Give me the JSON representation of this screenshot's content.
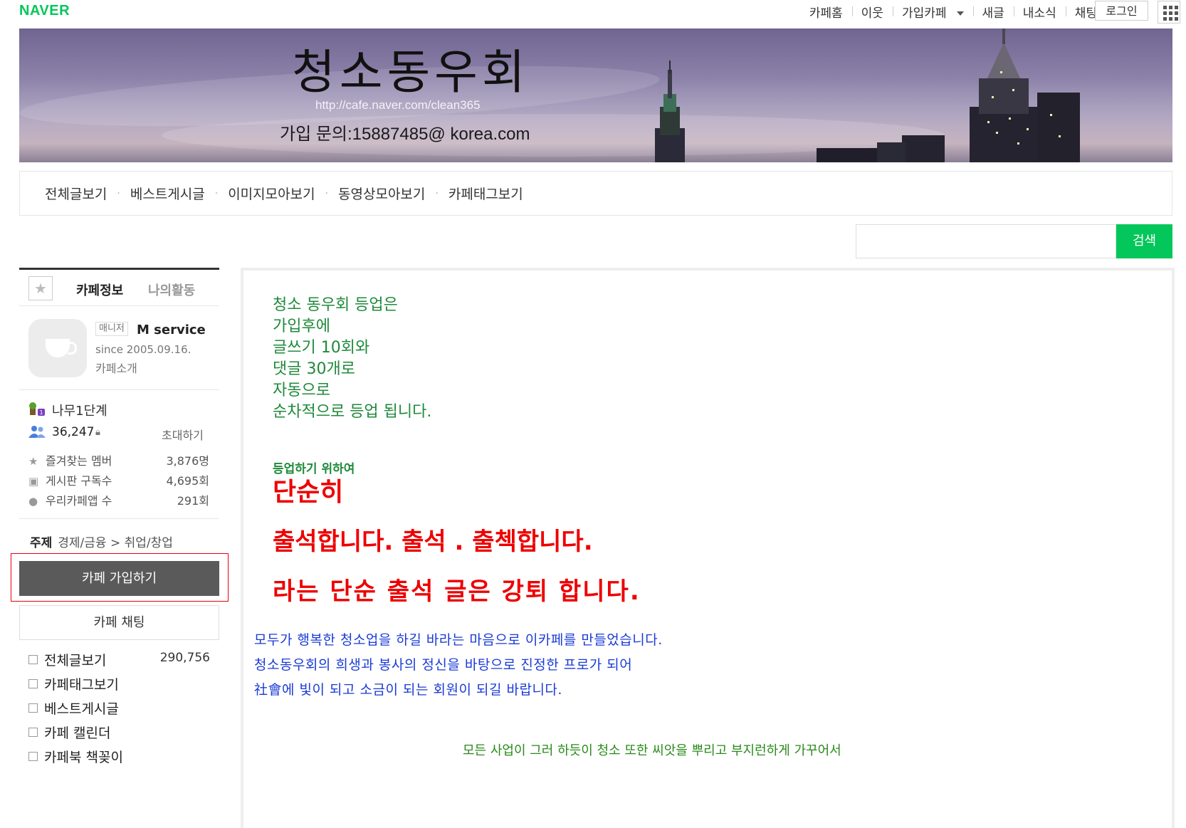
{
  "header": {
    "logo": "NAVER",
    "nav": [
      "카페홈",
      "이웃",
      "가입카페",
      "새글",
      "내소식",
      "채팅"
    ],
    "login": "로그인"
  },
  "banner": {
    "title": "청소동우회",
    "url": "http://cafe.naver.com/clean365",
    "contact": "가입 문의:15887485@ korea.com"
  },
  "menubar": [
    "전체글보기",
    "베스트게시글",
    "이미지모아보기",
    "동영상모아보기",
    "카페태그보기"
  ],
  "search": {
    "button": "검색",
    "placeholder": ""
  },
  "sidebar": {
    "tab_info": "카페정보",
    "tab_activity": "나의활동",
    "manager_badge": "매니저",
    "manager_name": "M service",
    "since": "since 2005.09.16.",
    "intro": "카페소개",
    "level": "나무1단계",
    "members": "36,247",
    "invite": "초대하기",
    "stats": [
      {
        "label": "즐겨찾는 멤버",
        "value": "3,876명"
      },
      {
        "label": "게시판 구독수",
        "value": "4,695회"
      },
      {
        "label": "우리카페앱 수",
        "value": "291회"
      }
    ],
    "topic_label": "주제",
    "topic_value": "경제/금융 > 취업/창업",
    "join_button": "카페 가입하기",
    "chat_button": "카페 채팅",
    "menu": [
      {
        "label": "전체글보기",
        "count": "290,756"
      },
      {
        "label": "카페태그보기",
        "count": ""
      },
      {
        "label": "베스트게시글",
        "count": ""
      },
      {
        "label": "카페 캘린더",
        "count": ""
      },
      {
        "label": "카페북 책꽂이",
        "count": ""
      }
    ]
  },
  "content": {
    "green_lines": [
      "청소 동우회 등업은",
      "가입후에",
      "글쓰기 10회와",
      "댓글 30개로",
      "자동으로",
      "순차적으로 등업 됩니다."
    ],
    "sub_green": "등업하기 위하여",
    "red1": "단순히",
    "red2": "출석합니다. 출석 . 출첵합니다.",
    "red3": "라는 단순 출석 글은 강퇴 합니다.",
    "blue_lines": [
      "모두가 행복한 청소업을 하길 바라는 마음으로 이카페를 만들었습니다.",
      "청소동우회의 희생과 봉사의 정신을 바탕으로 진정한 프로가 되어",
      "社會에 빛이 되고 소금이 되는 회원이 되길 바랍니다."
    ],
    "bottom_green": "모든 사업이 그러 하듯이 청소 또한 씨앗을 뿌리고 부지런하게 가꾸어서"
  },
  "colors": {
    "naver_green": "#03c75a",
    "join_button": "#5a5a5a",
    "highlight_border": "#e60012",
    "content_green": "#1f8a3a",
    "content_red": "#ee0000",
    "content_blue": "#1a3bd6"
  },
  "icons": [
    "star-icon",
    "cup-icon",
    "level-icon",
    "members-icon",
    "lock-icon",
    "star-small-icon",
    "rss-icon",
    "app-icon",
    "board-icon",
    "apps-grid-icon",
    "dropdown-caret-icon"
  ]
}
